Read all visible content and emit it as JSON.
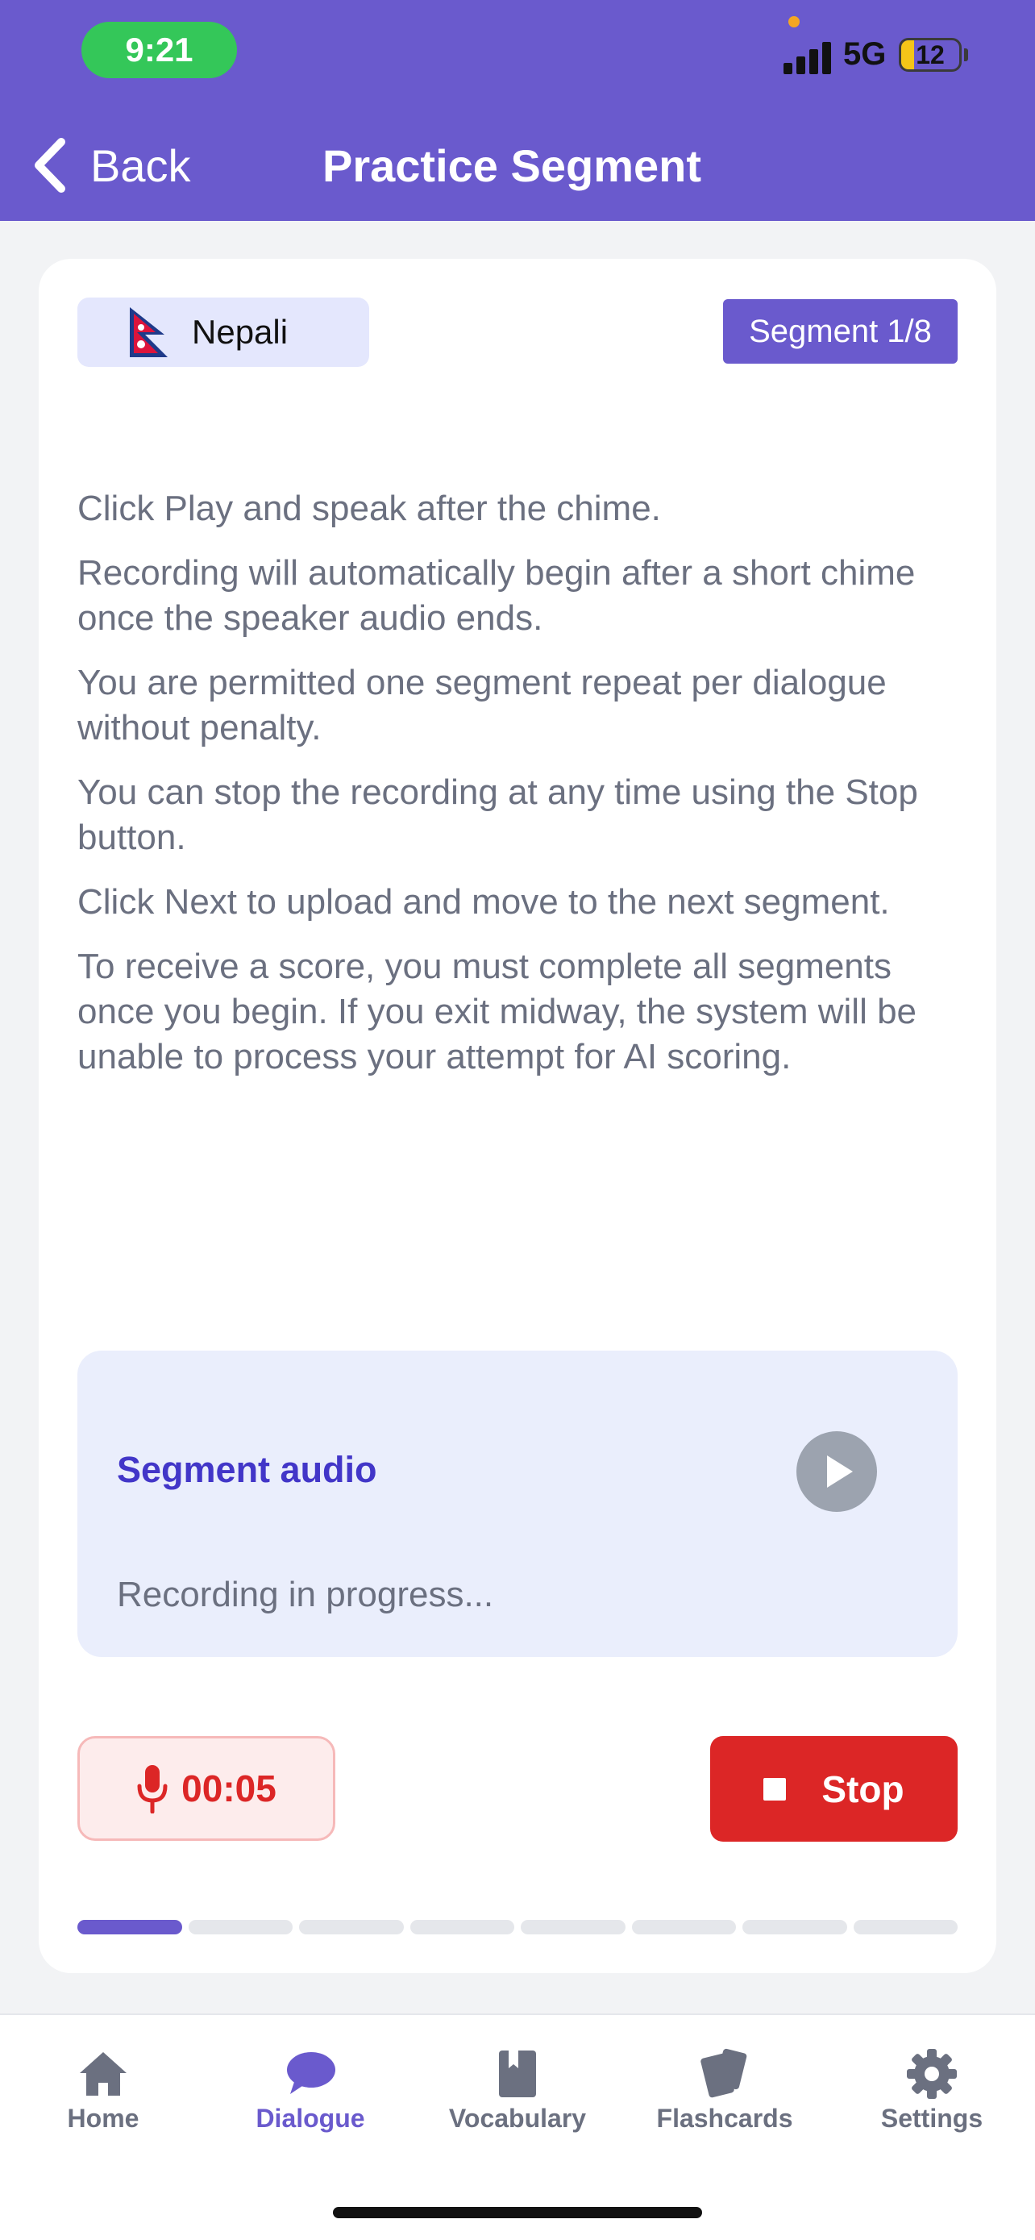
{
  "status_bar": {
    "time": "9:21",
    "network": "5G",
    "battery": "12",
    "battery_level": 0.12
  },
  "header": {
    "back_label": "Back",
    "title": "Practice Segment"
  },
  "card": {
    "language": "Nepali",
    "segment_badge": "Segment 1/8",
    "instructions": [
      "Click Play and speak after the chime.",
      "Recording will automatically begin after a short chime once the speaker audio ends.",
      "You are permitted one segment repeat per dialogue without penalty.",
      "You can stop the recording at any time using the Stop button.",
      "Click Next to upload and move to the next segment.",
      "To receive a score, you must complete all segments once you begin. If you exit midway, the system will be unable to process your attempt for AI scoring."
    ],
    "audio": {
      "title": "Segment audio",
      "status": "Recording in progress..."
    },
    "timer": "00:05",
    "stop_label": "Stop",
    "progress": {
      "current": 1,
      "total": 8
    }
  },
  "tabs": [
    {
      "label": "Home",
      "icon": "home-icon",
      "active": false
    },
    {
      "label": "Dialogue",
      "icon": "chat-bubble-icon",
      "active": true
    },
    {
      "label": "Vocabulary",
      "icon": "book-icon",
      "active": false
    },
    {
      "label": "Flashcards",
      "icon": "cards-icon",
      "active": false
    },
    {
      "label": "Settings",
      "icon": "gear-icon",
      "active": false
    }
  ],
  "colors": {
    "accent": "#6a5acd",
    "danger": "#dc2626",
    "status_green": "#34c759"
  }
}
